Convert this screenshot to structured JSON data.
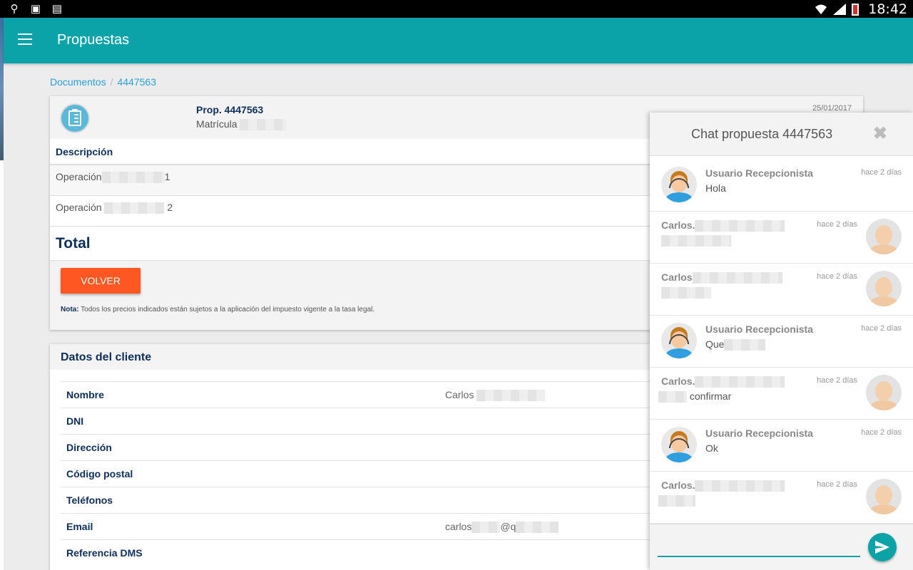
{
  "statusbar": {
    "time": "18:42"
  },
  "appbar": {
    "title": "Propuestas"
  },
  "breadcrumb": {
    "items": [
      "Documentos",
      "4447563"
    ]
  },
  "proposal": {
    "title": "Prop. 4447563",
    "subtitle": "Matrícula",
    "date": "25/01/2017",
    "description_header": "Descripción",
    "operations": [
      {
        "label": "Operación",
        "suffix": "1"
      },
      {
        "label": "Operación",
        "suffix": "2"
      }
    ],
    "total_label": "Total",
    "back_button": "VOLVER",
    "note_label": "Nota:",
    "note_text": " Todos los precios indicados están sujetos a la aplicación del impuesto vigente a la tasa legal."
  },
  "client": {
    "header": "Datos del cliente",
    "fields": [
      {
        "label": "Nombre",
        "value": "Carlos"
      },
      {
        "label": "DNI",
        "value": ""
      },
      {
        "label": "Dirección",
        "value": ""
      },
      {
        "label": "Código postal",
        "value": ""
      },
      {
        "label": "Teléfonos",
        "value": ""
      },
      {
        "label": "Email",
        "value": "carlos",
        "value_suffix": "@q"
      },
      {
        "label": "Referencia DMS",
        "value": ""
      }
    ]
  },
  "chat": {
    "title": "Chat propuesta 4447563",
    "input_placeholder": "",
    "messages": [
      {
        "from": "agent",
        "name": "Usuario Recepcionista",
        "text": "Hola",
        "time": "hace 2 días"
      },
      {
        "from": "user",
        "name": "Carlos.",
        "text": "",
        "time": "hace 2 días"
      },
      {
        "from": "user",
        "name": "Carlos",
        "text": "",
        "time": "hace 2 días"
      },
      {
        "from": "agent",
        "name": "Usuario Recepcionista",
        "text": "Que",
        "time": "hace 2 días"
      },
      {
        "from": "user",
        "name": "Carlos.",
        "text": "confirmar",
        "time": "hace 2 días"
      },
      {
        "from": "agent",
        "name": "Usuario Recepcionista",
        "text": "Ok",
        "time": "hace 2 días"
      },
      {
        "from": "user",
        "name": "Carlos.",
        "text": "",
        "time": "hace 2 días"
      }
    ]
  },
  "colors": {
    "primary": "#0ba2a8",
    "accent": "#ff5722",
    "heading": "#0d2f5a",
    "link": "#2a9fd6"
  },
  "icons": {
    "menu": "hamburger-icon",
    "proposal": "clipboard-icon",
    "close": "close-icon",
    "send": "send-icon"
  }
}
